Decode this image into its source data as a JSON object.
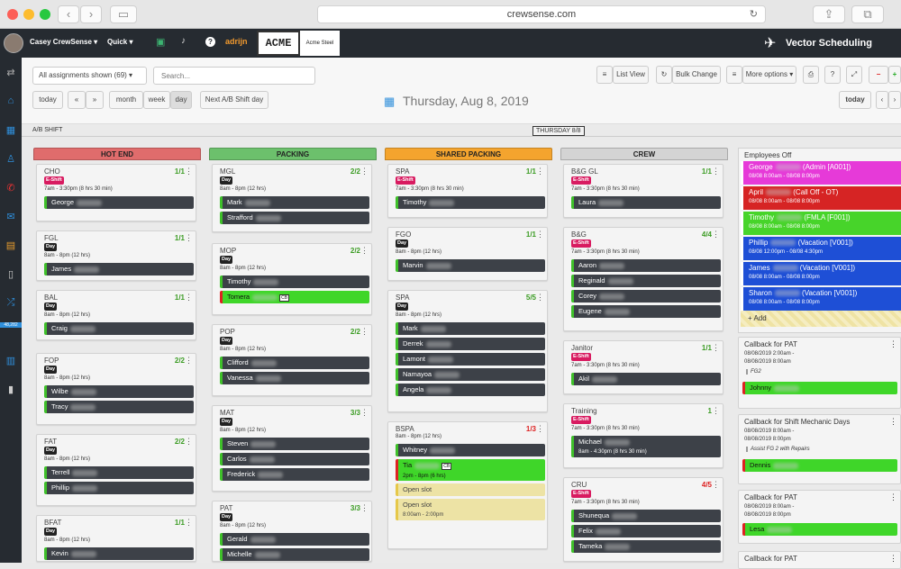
{
  "browser": {
    "url": "crewsense.com"
  },
  "appbar": {
    "user_name": "Casey CrewSense",
    "quick_label": "Quick",
    "brand_text": "adrijn",
    "company_logo": "ACME",
    "company_name": "Acme Steel",
    "product_name": "Vector Scheduling"
  },
  "sidebar": {
    "badge": "48,282"
  },
  "toolbar": {
    "assignments_filter": "All assignments shown (69)",
    "search_placeholder": "Search...",
    "list_view": "List View",
    "bulk_change": "Bulk Change",
    "more_options": "More options",
    "today": "today",
    "prev": "«",
    "next": "»",
    "month": "month",
    "week": "week",
    "day": "day",
    "next_ab": "Next A/B Shift day",
    "date_title": "Thursday, Aug 8, 2019",
    "today_right": "today",
    "shift_label": "A/B SHIFT",
    "day_chip": "THURSDAY 8/8"
  },
  "columns": [
    {
      "name": "HOT END",
      "color": "#e06c6c",
      "cards": [
        {
          "title": "CHO",
          "count": "1/1",
          "badge": "E-Shift",
          "time": "7am - 3:30pm (8 hrs 30 min)",
          "people": [
            {
              "name": "George",
              "style": "normal"
            }
          ]
        },
        {
          "title": "FGL",
          "count": "1/1",
          "badge": "Day",
          "time": "8am - 8pm (12 hrs)",
          "people": [
            {
              "name": "James",
              "style": "normal"
            }
          ]
        },
        {
          "title": "BAL",
          "count": "1/1",
          "badge": "Day",
          "time": "8am - 8pm (12 hrs)",
          "people": [
            {
              "name": "Craig",
              "style": "normal"
            }
          ]
        },
        {
          "title": "FOP",
          "count": "2/2",
          "badge": "Day",
          "time": "8am - 8pm (12 hrs)",
          "people": [
            {
              "name": "Wilbe",
              "style": "normal"
            },
            {
              "name": "Tracy",
              "style": "normal"
            }
          ]
        },
        {
          "title": "FAT",
          "count": "2/2",
          "badge": "Day",
          "time": "8am - 8pm (12 hrs)",
          "people": [
            {
              "name": "Terrell",
              "style": "normal"
            },
            {
              "name": "Phillip",
              "style": "normal"
            }
          ]
        },
        {
          "title": "BFAT",
          "count": "1/1",
          "badge": "Day",
          "time": "8am - 8pm (12 hrs)",
          "people": [
            {
              "name": "Kevin",
              "style": "normal"
            }
          ]
        }
      ]
    },
    {
      "name": "PACKING",
      "color": "#6cc06c",
      "cards": [
        {
          "title": "MGL",
          "count": "2/2",
          "badge": "Day",
          "time": "8am - 8pm (12 hrs)",
          "people": [
            {
              "name": "Mark",
              "style": "normal"
            },
            {
              "name": "Strafford",
              "style": "normal"
            }
          ]
        },
        {
          "title": "MOP",
          "count": "2/2",
          "badge": "Day",
          "time": "8am - 8pm (12 hrs)",
          "people": [
            {
              "name": "Timothy",
              "style": "normal"
            },
            {
              "name": "Tomera",
              "style": "green"
            }
          ]
        },
        {
          "title": "POP",
          "count": "2/2",
          "badge": "Day",
          "time": "8am - 8pm (12 hrs)",
          "people": [
            {
              "name": "Clifford",
              "style": "normal"
            },
            {
              "name": "Vanessa",
              "style": "normal"
            }
          ]
        },
        {
          "title": "MAT",
          "count": "3/3",
          "badge": "Day",
          "time": "8am - 8pm (12 hrs)",
          "people": [
            {
              "name": "Steven",
              "style": "normal"
            },
            {
              "name": "Carlos",
              "style": "normal"
            },
            {
              "name": "Frederick",
              "style": "normal"
            }
          ]
        },
        {
          "title": "PAT",
          "count": "3/3",
          "badge": "Day",
          "time": "8am - 8pm (12 hrs)",
          "people": [
            {
              "name": "Gerald",
              "style": "normal"
            },
            {
              "name": "Michelle",
              "style": "normal"
            }
          ]
        }
      ]
    },
    {
      "name": "SHARED PACKING",
      "color": "#f4a42e",
      "cards": [
        {
          "title": "SPA",
          "count": "1/1",
          "badge": "E-Shift",
          "time": "7am - 3:30pm (8 hrs 30 min)",
          "people": [
            {
              "name": "Timothy",
              "style": "normal"
            }
          ]
        },
        {
          "title": "FGO",
          "count": "1/1",
          "badge": "Day",
          "time": "8am - 8pm (12 hrs)",
          "people": [
            {
              "name": "Marvin",
              "style": "normal"
            }
          ]
        },
        {
          "title": "SPA",
          "count": "5/5",
          "badge": "Day",
          "time": "8am - 8pm (12 hrs)",
          "people": [
            {
              "name": "Mark",
              "style": "normal"
            },
            {
              "name": "Derrek",
              "style": "normal"
            },
            {
              "name": "Lamont",
              "style": "normal"
            },
            {
              "name": "Namayoa",
              "style": "normal"
            },
            {
              "name": "Angela",
              "style": "normal"
            }
          ]
        },
        {
          "title": "BSPA",
          "count": "1/3",
          "badge": "",
          "time": "8am - 8pm (12 hrs)",
          "people": [
            {
              "name": "Whitney",
              "style": "normal"
            },
            {
              "name": "Tia",
              "style": "green",
              "sub": "2pm - 8pm (6 hrs)"
            },
            {
              "name": "Open slot",
              "style": "open"
            },
            {
              "name": "Open slot",
              "style": "open",
              "sub": "8:00am - 2:00pm"
            }
          ]
        }
      ]
    },
    {
      "name": "CREW",
      "color": "#d4d4d4",
      "cards": [
        {
          "title": "B&G GL",
          "count": "1/1",
          "badge": "E-Shift",
          "time": "7am - 3:30pm (8 hrs 30 min)",
          "people": [
            {
              "name": "Laura",
              "style": "normal"
            }
          ]
        },
        {
          "title": "B&G",
          "count": "4/4",
          "badge": "E-Shift",
          "time": "7am - 3:30pm (8 hrs 30 min)",
          "people": [
            {
              "name": "Aaron",
              "style": "normal"
            },
            {
              "name": "Reginald",
              "style": "normal"
            },
            {
              "name": "Corey",
              "style": "normal"
            },
            {
              "name": "Eugene",
              "style": "normal"
            }
          ]
        },
        {
          "title": "Janitor",
          "count": "1/1",
          "badge": "E-Shift",
          "time": "7am - 3:30pm (8 hrs 30 min)",
          "people": [
            {
              "name": "Akil",
              "style": "normal"
            }
          ]
        },
        {
          "title": "Training",
          "count": "1",
          "badge": "E-Shift",
          "time": "7am - 3:30pm (8 hrs 30 min)",
          "people": [
            {
              "name": "Michael",
              "style": "normal",
              "sub": "8am - 4:30pm (8 hrs 30 min)"
            }
          ]
        },
        {
          "title": "CRU",
          "count": "4/5",
          "badge": "E-Shift",
          "time": "7am - 3:30pm (8 hrs 30 min)",
          "people": [
            {
              "name": "Shunequa",
              "style": "normal"
            },
            {
              "name": "Felix",
              "style": "normal"
            },
            {
              "name": "Tameka",
              "style": "normal"
            }
          ]
        }
      ]
    }
  ],
  "employees_off": {
    "title": "Employees Off",
    "rows": [
      {
        "name": "George",
        "reason": "(Admin [A001])",
        "time": "08/08 8:00am - 08/08 8:00pm",
        "color": "#e63ad8"
      },
      {
        "name": "April",
        "reason": "(Call Off - OT)",
        "time": "08/08 8:00am - 08/08 8:00pm",
        "color": "#d62424"
      },
      {
        "name": "Timothy",
        "reason": "(FMLA [F001])",
        "time": "08/08 8:00am - 08/08 8:00pm",
        "color": "#47d42a"
      },
      {
        "name": "Phillip",
        "reason": "(Vacation [V001])",
        "time": "08/08 12:00pm - 08/08 4:30pm",
        "color": "#1e4fd6"
      },
      {
        "name": "James",
        "reason": "(Vacation [V001])",
        "time": "08/08 8:00am - 08/08 8:00pm",
        "color": "#1e4fd6"
      },
      {
        "name": "Sharon",
        "reason": "(Vacation [V001])",
        "time": "08/08 8:00am - 08/08 8:00pm",
        "color": "#1e4fd6"
      }
    ],
    "add": "+ Add"
  },
  "callbacks": [
    {
      "title": "Callback for PAT",
      "times": [
        "08/08/2019 2:00am -",
        "08/08/2019 8:00am"
      ],
      "note": "FG2",
      "person": "Johnny"
    },
    {
      "title": "Callback for Shift Mechanic Days",
      "times": [
        "08/08/2019 8:00am -",
        "08/08/2019 8:00pm"
      ],
      "note": "Assist FG 2 with Repairs",
      "person": "Dennis"
    },
    {
      "title": "Callback for PAT",
      "times": [
        "08/08/2019 8:00am -",
        "08/08/2019 8:00pm"
      ],
      "note": "",
      "person": "Lesa"
    },
    {
      "title": "Callback for PAT",
      "times": [],
      "note": "",
      "person": ""
    }
  ],
  "cb_tag": "CB"
}
